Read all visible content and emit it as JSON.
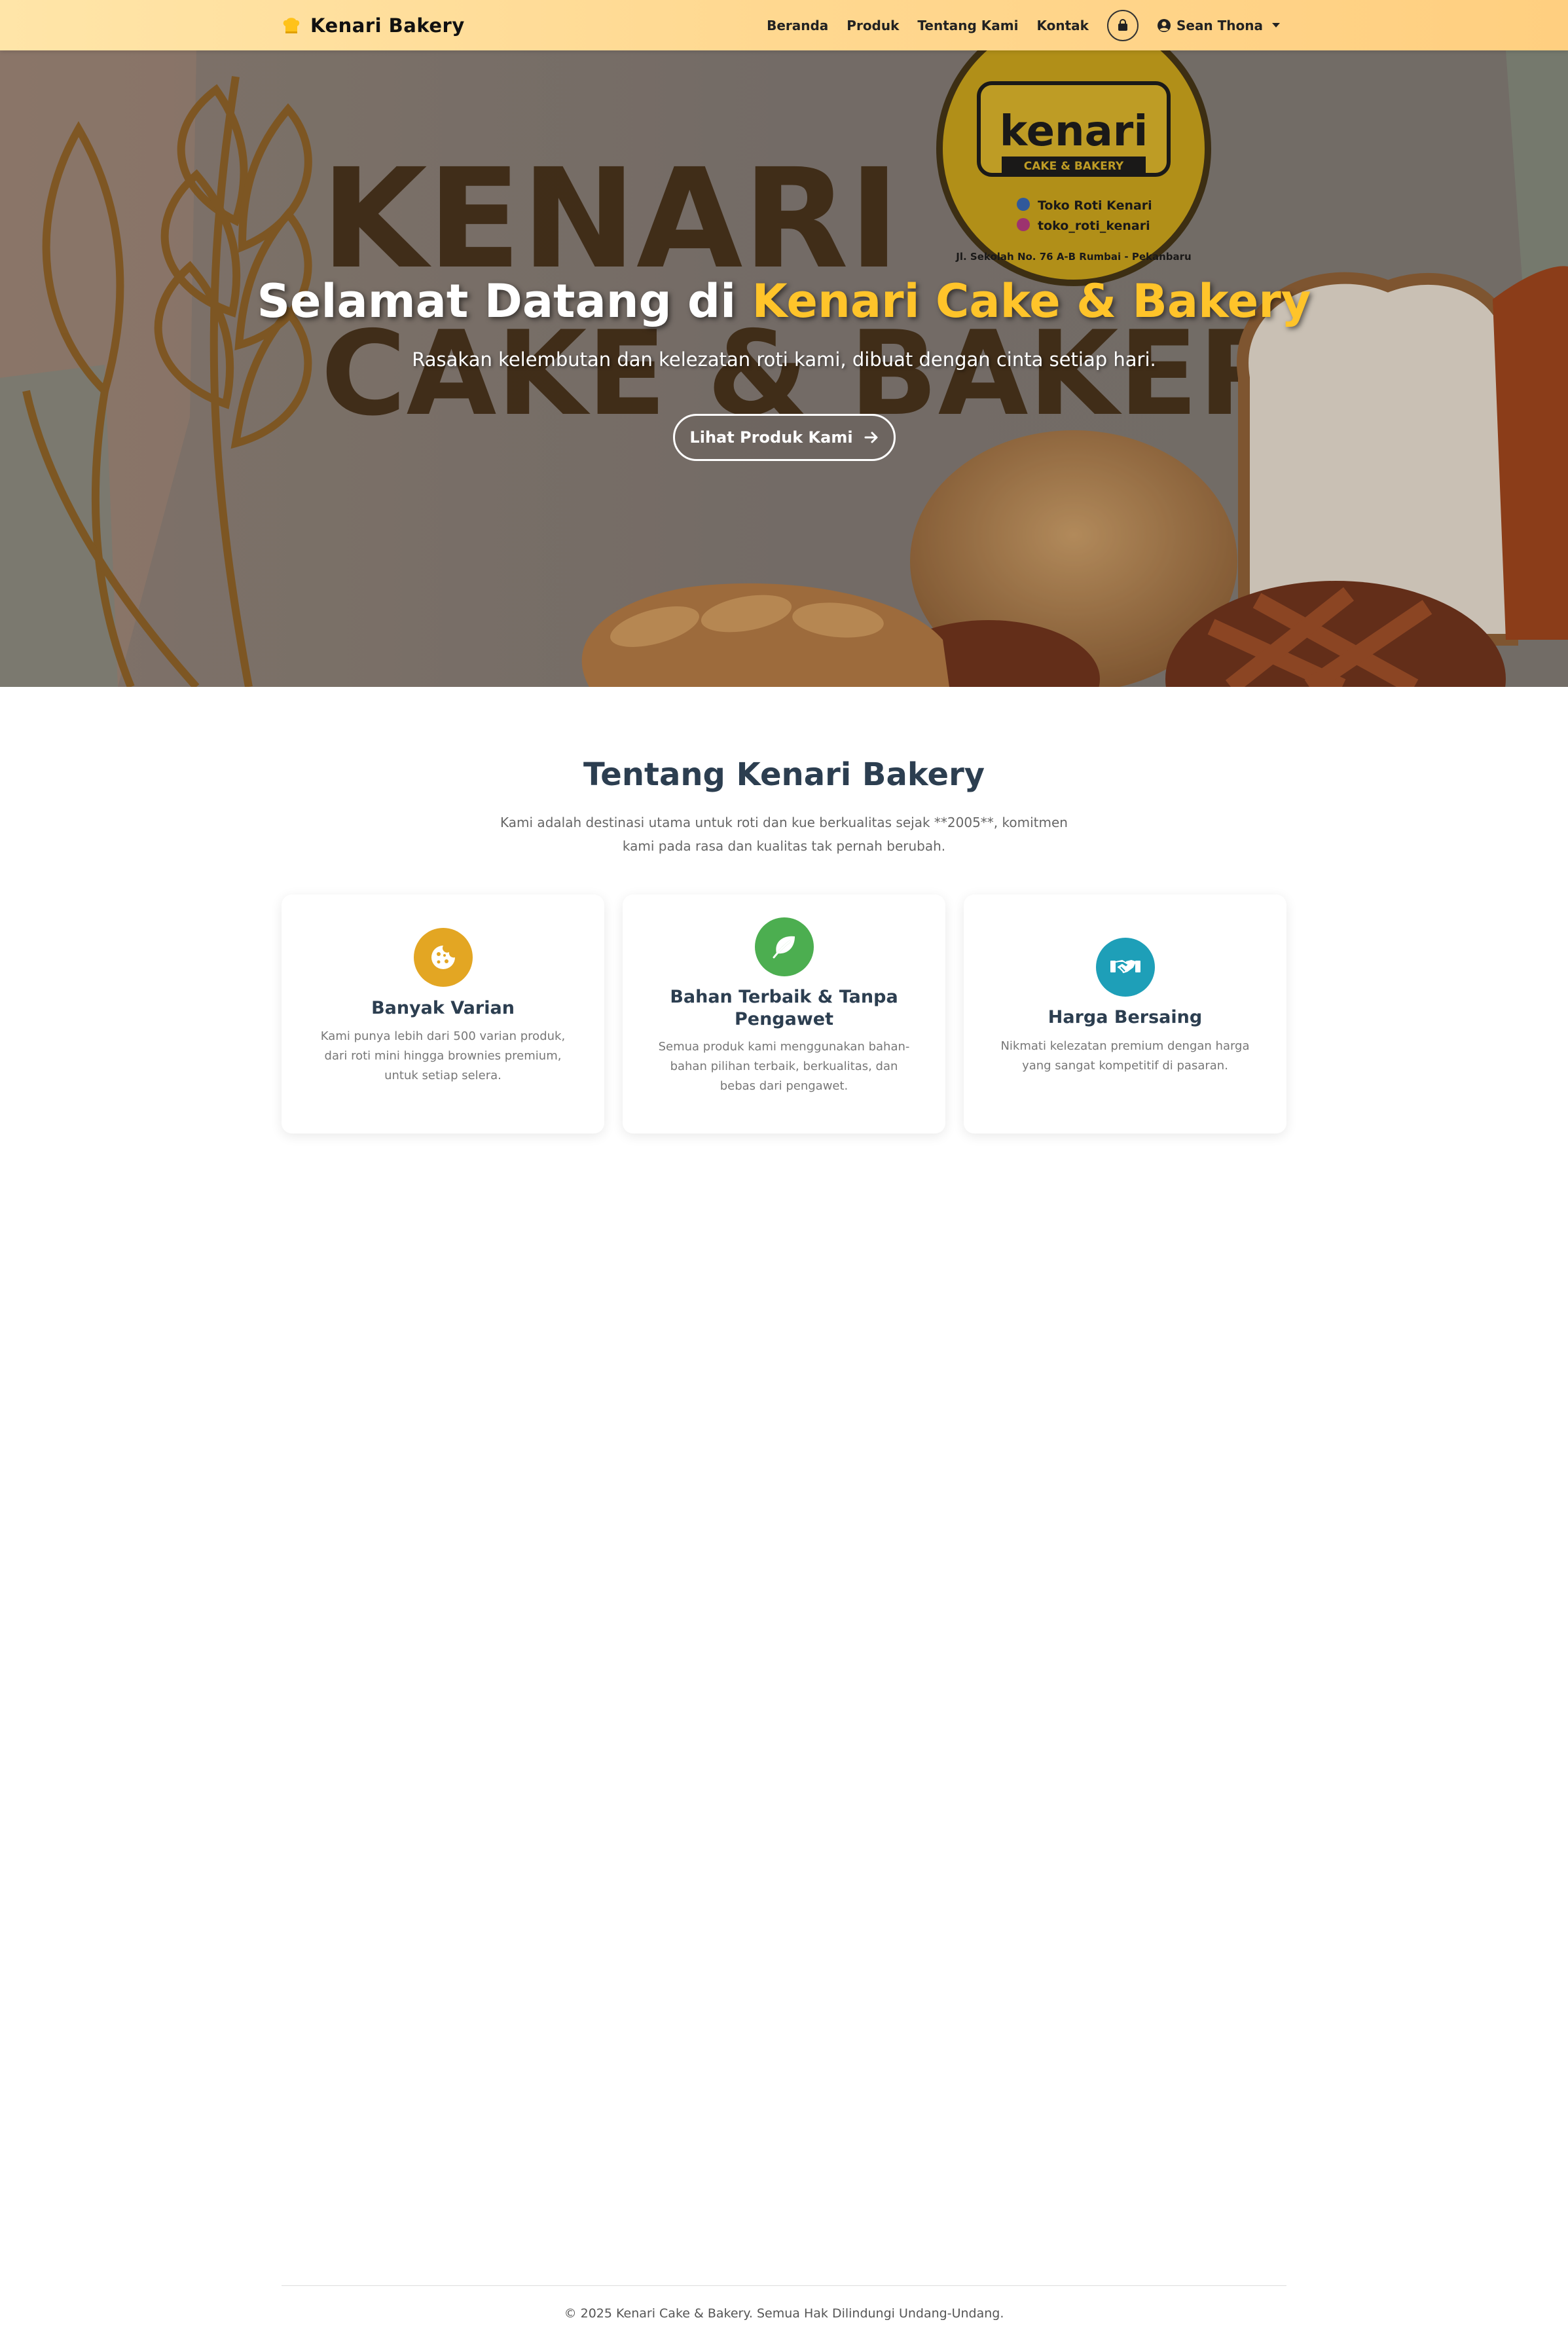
{
  "navbar": {
    "brand": "Kenari Bakery",
    "brand_icon": "chef-hat-icon",
    "links": [
      "Beranda",
      "Produk",
      "Tentang Kami",
      "Kontak"
    ],
    "cart_icon": "shopping-bag-icon",
    "user_icon": "user-circle-icon",
    "user_name": "Sean Thona"
  },
  "hero": {
    "title_prefix": "Selamat Datang di ",
    "title_accent": "Kenari Cake & Bakery",
    "subtitle": "Rasakan kelembutan dan kelezatan roti kami, dibuat dengan cinta setiap hari.",
    "button_label": "Lihat Produk Kami",
    "button_icon": "arrow-right-icon",
    "logo": {
      "name": "kenari",
      "tagline": "CAKE & BAKERY",
      "facebook": "Toko Roti Kenari",
      "instagram": "toko_roti_kenari",
      "address": "Jl. Sekolah No. 76 A-B Rumbai - Pekanbaru"
    },
    "bg_words": [
      "KENARI",
      "CAKE & BAKERY"
    ]
  },
  "about": {
    "title": "Tentang Kenari Bakery",
    "text": "Kami adalah destinasi utama untuk roti dan kue berkualitas sejak **2005**, komitmen kami pada rasa dan kualitas tak pernah berubah.",
    "cards": [
      {
        "icon": "cookie-icon",
        "color": "#e3a623",
        "title": "Banyak Varian",
        "text": "Kami punya lebih dari 500 varian produk, dari roti mini hingga brownies premium, untuk setiap selera."
      },
      {
        "icon": "leaf-icon",
        "color": "#4cae50",
        "title": "Bahan Terbaik & Tanpa Pengawet",
        "text": "Semua produk kami menggunakan bahan-bahan pilihan terbaik, berkualitas, dan bebas dari pengawet."
      },
      {
        "icon": "handshake-icon",
        "color": "#1e9fb8",
        "title": "Harga Bersaing",
        "text": "Nikmati kelezatan premium dengan harga yang sangat kompetitif di pasaran."
      }
    ]
  },
  "footer": {
    "text": "© 2025 Kenari Cake & Bakery. Semua Hak Dilindungi Undang-Undang."
  },
  "colors": {
    "accent": "#ffc42a",
    "heading": "#2c3e50",
    "navbar": "#ffd890"
  }
}
